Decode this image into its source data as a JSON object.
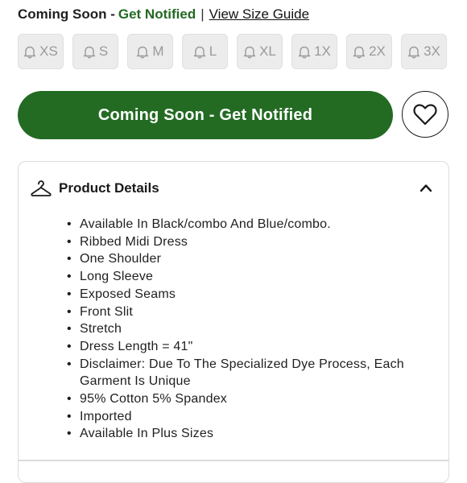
{
  "colors": {
    "accent_green": "#236a23",
    "cta_green": "#236b23"
  },
  "header": {
    "status_prefix": "Coming Soon -",
    "status_notify": "Get Notified",
    "separator": "|",
    "size_guide_link": "View Size Guide"
  },
  "sizes": [
    {
      "label": "XS",
      "icon": "bell-icon"
    },
    {
      "label": "S",
      "icon": "bell-icon"
    },
    {
      "label": "M",
      "icon": "bell-icon"
    },
    {
      "label": "L",
      "icon": "bell-icon"
    },
    {
      "label": "XL",
      "icon": "bell-icon"
    },
    {
      "label": "1X",
      "icon": "bell-icon"
    },
    {
      "label": "2X",
      "icon": "bell-icon"
    },
    {
      "label": "3X",
      "icon": "bell-icon"
    }
  ],
  "cta": {
    "label": "Coming Soon - Get Notified",
    "wishlist_icon": "heart-icon"
  },
  "product_details": {
    "icon": "hanger-icon",
    "title": "Product Details",
    "toggle_icon": "chevron-up-icon",
    "bullets": [
      "Available In Black/combo And Blue/combo.",
      "Ribbed Midi Dress",
      "One Shoulder",
      "Long Sleeve",
      "Exposed Seams",
      "Front Slit",
      "Stretch",
      "Dress Length = 41\"",
      "Disclaimer: Due To The Specialized Dye Process, Each Garment Is Unique",
      "95% Cotton 5% Spandex",
      "Imported",
      "Available In Plus Sizes"
    ]
  }
}
